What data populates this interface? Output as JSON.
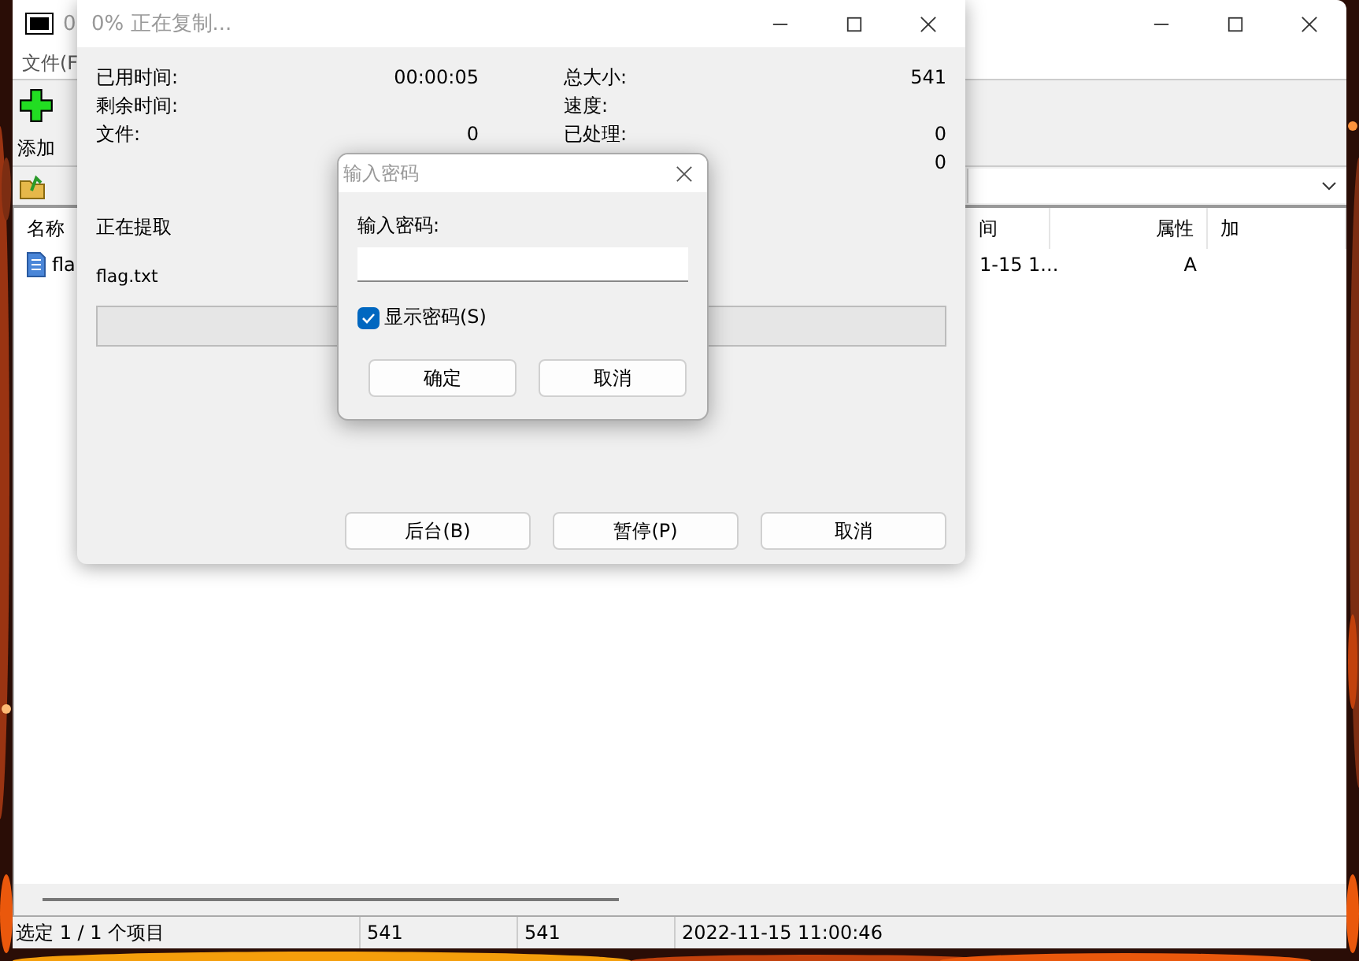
{
  "main_window": {
    "title": "0",
    "menu": [
      "文件(F"
    ],
    "toolbar": [
      {
        "label": "添加"
      }
    ],
    "list": {
      "columns": [
        "名称",
        "间",
        "属性",
        "加"
      ],
      "rows": [
        {
          "cells": [
            "fla",
            "1-15 1...",
            "A"
          ]
        }
      ]
    },
    "status_bar": [
      "选定 1 / 1 个项目",
      "541",
      "541",
      "2022-11-15 11:00:46"
    ]
  },
  "progress_window": {
    "title": "0% 正在复制...",
    "stats_left": [
      {
        "label": "已用时间:",
        "value": "00:00:05"
      },
      {
        "label": "剩余时间:"
      },
      {
        "label": "文件:",
        "value": "0"
      }
    ],
    "stats_right": [
      {
        "label": "总大小:",
        "value": "541"
      },
      {
        "label": "速度:"
      },
      {
        "label": "已处理:",
        "value": "0"
      },
      {
        "value": "0"
      }
    ],
    "operation": "正在提取",
    "file": "flag.txt",
    "progress": {
      "level": 0
    },
    "buttons": [
      "后台(B)",
      "暂停(P)",
      "取消"
    ]
  },
  "password_dialog": {
    "title": "输入密码",
    "label": "输入密码:",
    "show_password": {
      "label": "显示密码(S)",
      "checked": true
    },
    "buttons": [
      "确定",
      "取消"
    ]
  }
}
